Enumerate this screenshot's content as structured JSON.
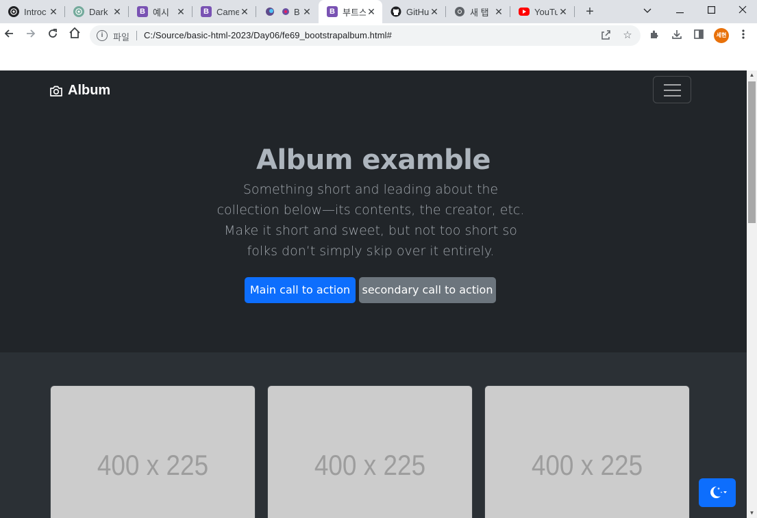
{
  "browser": {
    "tabs": [
      {
        "title": "Introc",
        "icon": "chatgpt-icon",
        "color": "#202124"
      },
      {
        "title": "Dark",
        "icon": "chatgpt-icon",
        "color": "#74aa9c"
      },
      {
        "title": "예시",
        "icon": "bootstrap-icon",
        "color": "#7952b3"
      },
      {
        "title": "Came",
        "icon": "bootstrap-icon",
        "color": "#7952b3"
      },
      {
        "title": "B",
        "icon": "extension-icon",
        "color": "#5f4b8b"
      },
      {
        "title": "부트스",
        "icon": "bootstrap-icon",
        "color": "#7952b3",
        "active": true
      },
      {
        "title": "GitHu",
        "icon": "github-icon",
        "color": "#202124"
      },
      {
        "title": "새 탭",
        "icon": "chrome-icon",
        "color": "#5f6368"
      },
      {
        "title": "YouTu",
        "icon": "youtube-icon",
        "color": "#ff0000"
      }
    ],
    "address": {
      "scheme_label": "파일",
      "url": "C:/Source/basic-html-2023/Day06/fe69_bootstrapalbum.html#"
    },
    "profile_label": "세현"
  },
  "page": {
    "brand": "Album",
    "hero": {
      "title": "Album examble",
      "lead": "Something short and leading about the collection below—its contents, the creator, etc. Make it short and sweet, but not too short so folks don’t simply skip over it entirely.",
      "primary_button": "Main call to action",
      "secondary_button": "secondary call to action"
    },
    "cards": [
      {
        "placeholder": "400 x 225"
      },
      {
        "placeholder": "400 x 225"
      },
      {
        "placeholder": "400 x 225"
      }
    ],
    "colors": {
      "navbar_bg": "#212529",
      "album_bg": "#2b3035",
      "primary": "#0d6efd",
      "secondary": "#6c757d"
    }
  }
}
